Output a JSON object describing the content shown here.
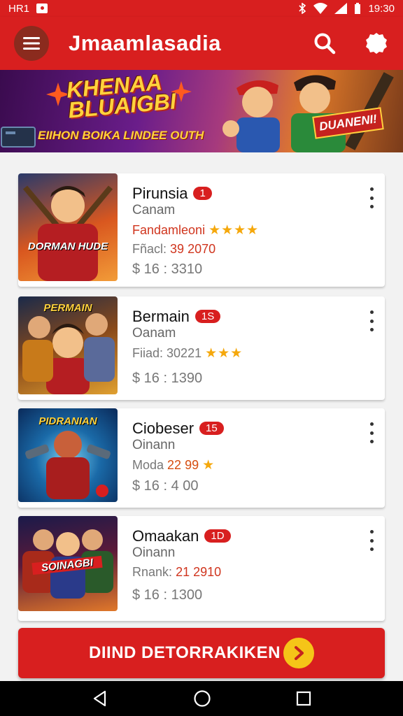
{
  "status_bar": {
    "left_text": "HR1",
    "time": "19:30"
  },
  "app_bar": {
    "title": "Jmaamlasadia"
  },
  "banner": {
    "title_line1": "KHENAA",
    "title_line2": "BLUAIGBI",
    "subtitle": "EIIHON BOIKA LINDEE OUTH",
    "badge": "DUANENI!"
  },
  "cards": [
    {
      "name": "Pirunsia",
      "badge": "1",
      "sub": "Canam",
      "line3_label": "Fandamleoni",
      "line3_value": "",
      "stars": "★★★★",
      "price": "$ 16 : 3310",
      "thumb_label": "DORMAN HUDE",
      "thumb_colors": [
        "#7a1a1a",
        "#d9571f",
        "#f29c38"
      ]
    },
    {
      "name": "Bermain",
      "badge": "1S",
      "sub": "Oanam",
      "line3_label": "Fiiad:",
      "line3_value": "30221",
      "stars": "★★★",
      "price": "$ 16 : 1390",
      "thumb_label": "PERMAIN",
      "thumb_colors": [
        "#3a2a1a",
        "#8a4a1a",
        "#e0a030"
      ]
    },
    {
      "name": "Ciobeser",
      "badge": "15",
      "sub": "Oinann",
      "line3_label": "Moda",
      "line3_value": "22 99",
      "stars": "★",
      "price": "$ 16 : 4 00",
      "thumb_label": "PIDRANIAN",
      "thumb_colors": [
        "#0a3a6a",
        "#1a6aa8",
        "#e05a2a"
      ]
    },
    {
      "name": "Omaakan",
      "badge": "1D",
      "sub": "Oinann",
      "line3_label": "Rnank:",
      "line3_value": "21 2910",
      "stars": "",
      "price": "$ 16 : 1300",
      "thumb_label": "SOINAGBI",
      "thumb_colors": [
        "#1a1a4a",
        "#a82a1a",
        "#f0b030"
      ]
    }
  ],
  "cta": {
    "label": "DIIND DETORRAKIKEN"
  },
  "colors": {
    "primary": "#d81f1f",
    "star": "#f5a80c",
    "accent_yellow": "#f5c518"
  },
  "icons": {
    "menu": "hamburger-icon",
    "search": "search-icon",
    "settings": "gear-icon",
    "more": "more-vertical-icon"
  }
}
